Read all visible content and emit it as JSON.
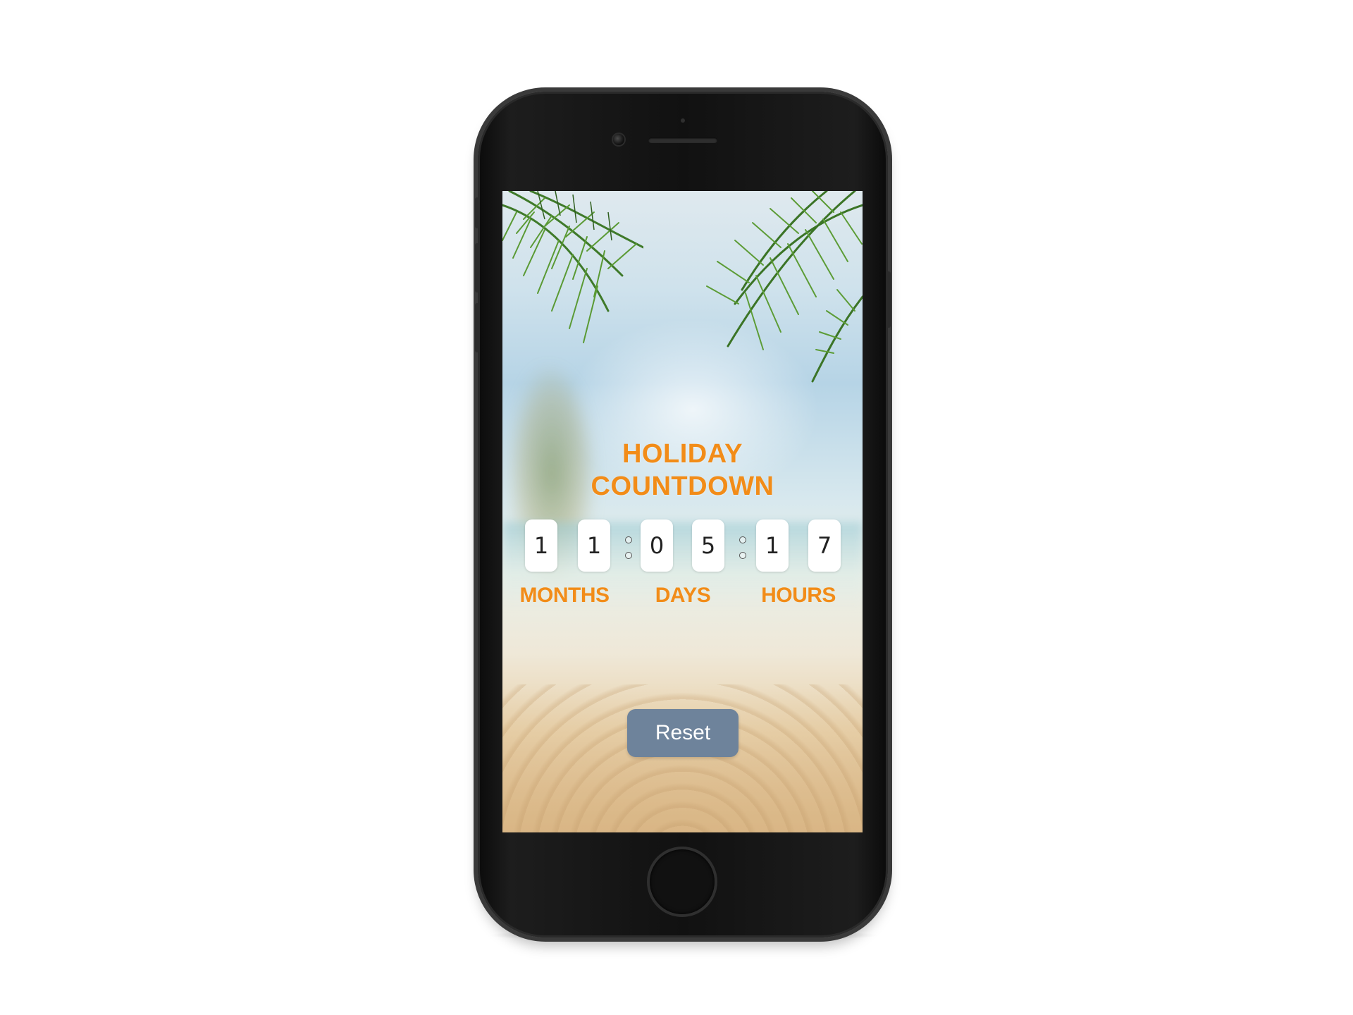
{
  "title": {
    "line1": "HOLIDAY",
    "line2": "COUNTDOWN"
  },
  "countdown": {
    "months": [
      "1",
      "1"
    ],
    "days": [
      "0",
      "5"
    ],
    "hours": [
      "1",
      "7"
    ],
    "labels": {
      "months": "MONTHS",
      "days": "DAYS",
      "hours": "HOURS"
    }
  },
  "buttons": {
    "reset": "Reset"
  },
  "colors": {
    "accent": "#f28c18",
    "button": "#6e839b",
    "phone": "#111111"
  },
  "icons": {
    "camera": "front-camera-icon",
    "speaker": "earpiece-speaker-icon",
    "home": "home-button-icon"
  }
}
